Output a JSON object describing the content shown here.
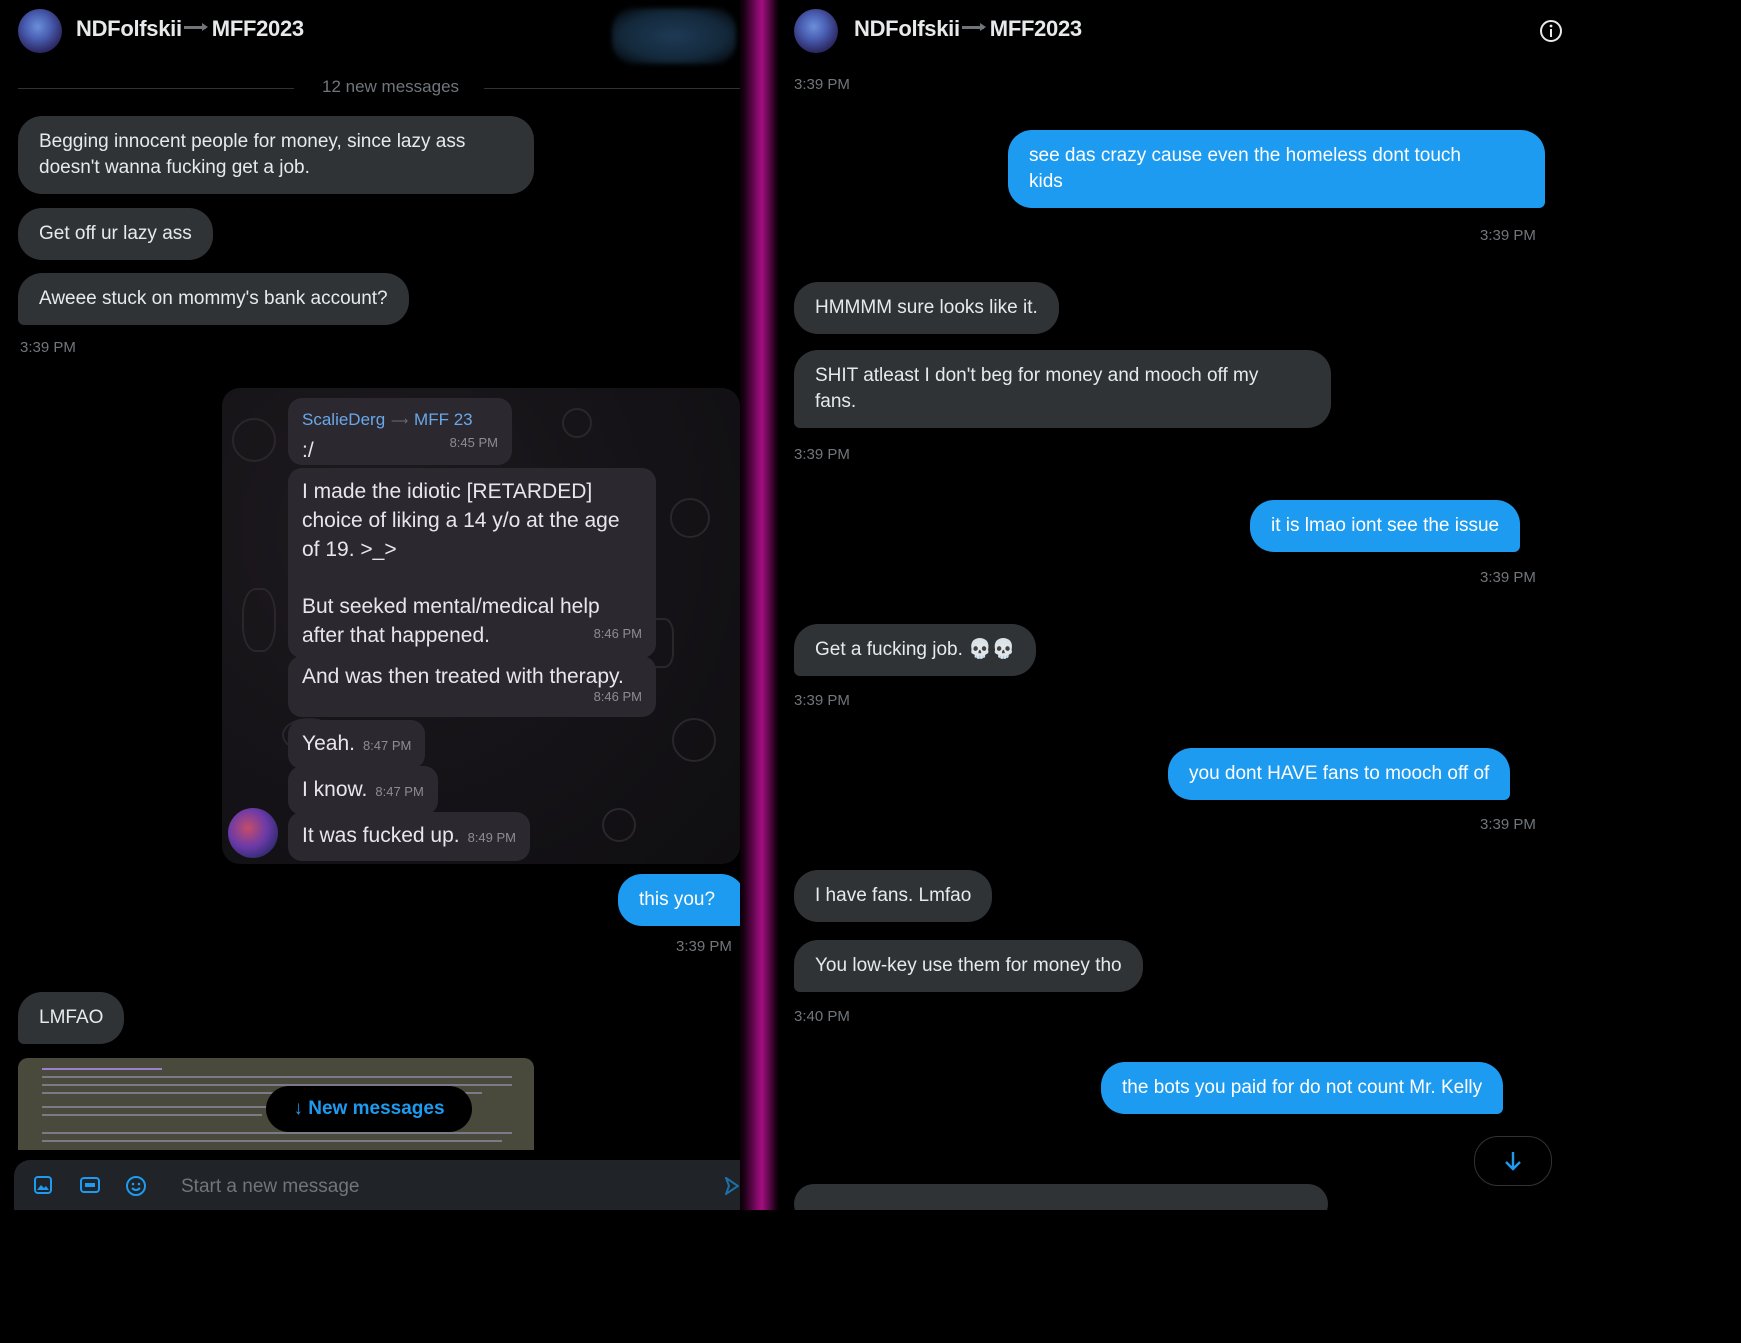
{
  "left_panel": {
    "header": {
      "user": "NDFolfskii",
      "suffix": "MFF2023"
    },
    "divider": "12 new messages",
    "messages": [
      {
        "text_l1": "Begging innocent people for money, since lazy ass",
        "text_l2": "doesn't wanna fucking get a job."
      },
      {
        "text": "Get off ur lazy ass"
      },
      {
        "text": "Aweee stuck on mommy's bank account?"
      }
    ],
    "time1": "3:39 PM",
    "embedded": {
      "sender": "ScalieDerg",
      "sender_tag": "MFF 23",
      "m1": {
        "text": ":/",
        "time": "8:45 PM"
      },
      "m2": {
        "l1": "I made the idiotic [RETARDED]",
        "l2": "choice of liking a 14 y/o at the age",
        "l3": "of 19. >_>",
        "l4": "But seeked mental/medical help",
        "l5": "after that happened.",
        "time": "8:46 PM"
      },
      "m3": {
        "text": "And was then treated with therapy.",
        "time": "8:46 PM"
      },
      "m4": {
        "text": "Yeah.",
        "time": "8:47 PM"
      },
      "m5": {
        "text": "I know.",
        "time": "8:47 PM"
      },
      "m6": {
        "text": "It was fucked up.",
        "time": "8:49 PM"
      }
    },
    "out_msg": "this you?",
    "time2": "3:39 PM",
    "lmfao": "LMFAO",
    "new_messages": "↓ New messages",
    "composer_placeholder": "Start a new message"
  },
  "right_panel": {
    "header": {
      "user": "NDFolfskii",
      "suffix": "MFF2023"
    },
    "t0": "3:39 PM",
    "out1_l1": "see das crazy cause even the homeless dont touch",
    "out1_l2": "kids",
    "t1": "3:39 PM",
    "in1": "HMMMM sure looks like it.",
    "in2_l1": "SHIT atleast I don't beg for money and mooch off my",
    "in2_l2": "fans.",
    "t2": "3:39 PM",
    "out2": "it is lmao iont see the issue",
    "t3": "3:39 PM",
    "in3": "Get a fucking job. 💀💀",
    "t4": "3:39 PM",
    "out3": "you dont HAVE fans to mooch off of",
    "t5": "3:39 PM",
    "in4": "I have fans. Lmfao",
    "in5": "You low-key use them for money tho",
    "t6": "3:40 PM",
    "out4": "the bots you paid for do not count Mr. Kelly"
  },
  "colors": {
    "accent": "#1d9bf0",
    "bubble_in": "#2f3336",
    "background": "#000000",
    "muted": "#71767b"
  }
}
